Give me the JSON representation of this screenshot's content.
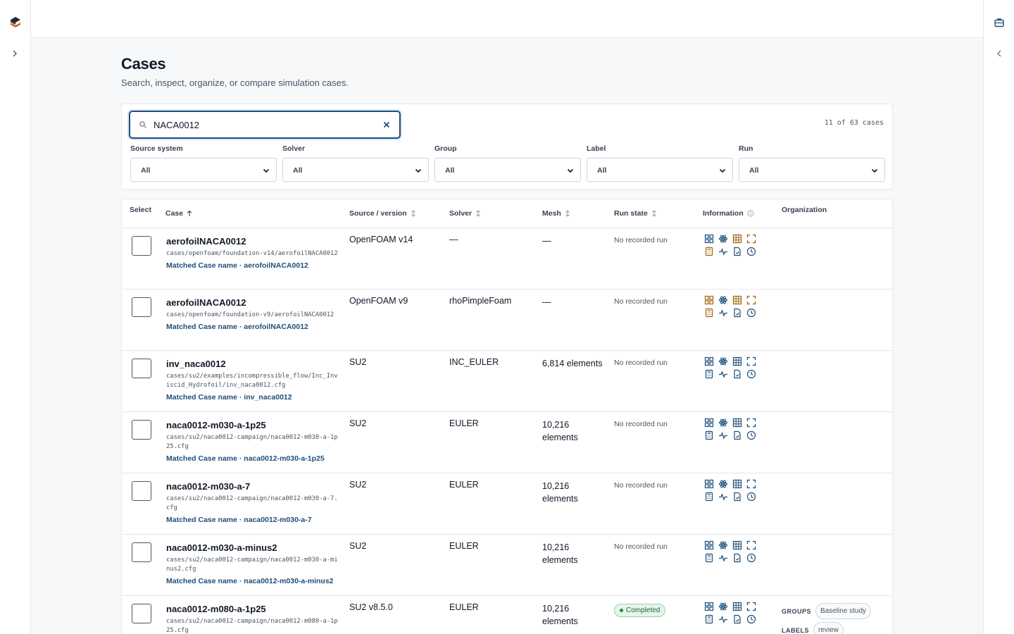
{
  "header": {
    "title": "Cases",
    "subtitle": "Search, inspect, organize, or compare simulation cases."
  },
  "search": {
    "value": "NACA0012",
    "count_text": "11 of 63 cases"
  },
  "filters": [
    {
      "label": "Source system",
      "value": "All"
    },
    {
      "label": "Solver",
      "value": "All"
    },
    {
      "label": "Group",
      "value": "All"
    },
    {
      "label": "Label",
      "value": "All"
    },
    {
      "label": "Run",
      "value": "All"
    }
  ],
  "table": {
    "columns": {
      "select": "Select",
      "case": "Case",
      "source": "Source / version",
      "solver": "Solver",
      "mesh": "Mesh",
      "run_state": "Run state",
      "information": "Information",
      "organization": "Organization"
    },
    "rows": [
      {
        "name": "aerofoilNACA0012",
        "path": "cases/openfoam/foundation-v14/aerofoilNACA0012",
        "match": "Matched Case name · aerofoilNACA0012",
        "source": "OpenFOAM v14",
        "solver": "—",
        "mesh": "—",
        "run_state": "No recorded run",
        "info_color": "#a16207"
      },
      {
        "name": "aerofoilNACA0012",
        "path": "cases/openfoam/foundation-v9/aerofoilNACA0012",
        "match": "Matched Case name · aerofoilNACA0012",
        "source": "OpenFOAM v9",
        "solver": "rhoPimpleFoam",
        "mesh": "—",
        "run_state": "No recorded run",
        "info_color": "#a16207"
      },
      {
        "name": "inv_naca0012",
        "path": "cases/su2/examples/incompressible_flow/Inc_Inviscid_Hydrofoil/inv_naca0012.cfg",
        "match": "Matched Case name · inv_naca0012",
        "source": "SU2",
        "solver": "INC_EULER",
        "mesh": "6,814 elements",
        "run_state": "No recorded run",
        "info_color": "#1f4e79"
      },
      {
        "name": "naca0012-m030-a-1p25",
        "path": "cases/su2/naca0012-campaign/naca0012-m030-a-1p25.cfg",
        "match": "Matched Case name · naca0012-m030-a-1p25",
        "source": "SU2",
        "solver": "EULER",
        "mesh": "10,216 elements",
        "run_state": "No recorded run",
        "info_color": "#1f4e79"
      },
      {
        "name": "naca0012-m030-a-7",
        "path": "cases/su2/naca0012-campaign/naca0012-m030-a-7.cfg",
        "match": "Matched Case name · naca0012-m030-a-7",
        "source": "SU2",
        "solver": "EULER",
        "mesh": "10,216 elements",
        "run_state": "No recorded run",
        "info_color": "#1f4e79"
      },
      {
        "name": "naca0012-m030-a-minus2",
        "path": "cases/su2/naca0012-campaign/naca0012-m030-a-minus2.cfg",
        "match": "Matched Case name · naca0012-m030-a-minus2",
        "source": "SU2",
        "solver": "EULER",
        "mesh": "10,216 elements",
        "run_state": "No recorded run",
        "info_color": "#1f4e79"
      },
      {
        "name": "naca0012-m080-a-1p25",
        "path": "cases/su2/naca0012-campaign/naca0012-m080-a-1p25.cfg",
        "match": "",
        "source": "SU2 v8.5.0",
        "solver": "EULER",
        "mesh": "10,216 elements",
        "run_state": "Completed",
        "info_color": "#1f4e79",
        "groups_key": "GROUPS",
        "group": "Baseline study",
        "labels_key": "LABELS",
        "label": "review"
      }
    ]
  }
}
